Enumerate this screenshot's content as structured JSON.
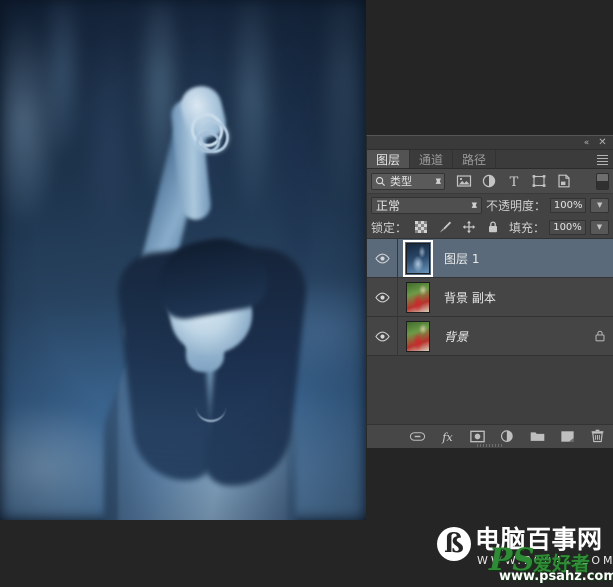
{
  "canvas": {
    "name": "blue-toned-portrait-photo",
    "description": "Blue duotone photograph of a young woman reaching upward holding rings, blurred forest background"
  },
  "panel": {
    "titlebar": {
      "collapse_icon": "collapse-double-arrow-icon",
      "collapse_glyph": "«",
      "close_icon": "close-icon",
      "close_glyph": "✕"
    },
    "tabs": [
      {
        "label": "图层",
        "name": "tab-layers",
        "active": true
      },
      {
        "label": "通道",
        "name": "tab-channels",
        "active": false
      },
      {
        "label": "路径",
        "name": "tab-paths",
        "active": false
      }
    ],
    "menu_icon": "panel-menu-icon",
    "filter_row": {
      "search_icon": "search-icon",
      "filter_type_value": "类型",
      "icons": [
        {
          "name": "filter-pixel-layers-icon",
          "title": "pixel"
        },
        {
          "name": "filter-adjustment-layers-icon",
          "title": "adjustment"
        },
        {
          "name": "filter-type-layers-icon",
          "title": "type"
        },
        {
          "name": "filter-shape-layers-icon",
          "title": "shape"
        },
        {
          "name": "filter-smart-object-icon",
          "title": "smart object"
        }
      ],
      "toggle_name": "filter-enable-toggle"
    },
    "mode_row": {
      "blend_mode": "正常",
      "opacity_label": "不透明度：",
      "opacity_value": "100%"
    },
    "lock_row": {
      "lock_label": "锁定：",
      "lock_icons": [
        {
          "name": "lock-transparent-pixels-icon"
        },
        {
          "name": "lock-image-pixels-icon"
        },
        {
          "name": "lock-position-icon"
        },
        {
          "name": "lock-all-icon"
        }
      ],
      "fill_label": "填充：",
      "fill_value": "100%"
    },
    "layers": [
      {
        "name": "图层 1",
        "visible": true,
        "selected": true,
        "italic": false,
        "locked": false,
        "thumb": "blue"
      },
      {
        "name": "背景 副本",
        "visible": true,
        "selected": false,
        "italic": false,
        "locked": false,
        "thumb": "color"
      },
      {
        "name": "背景",
        "visible": true,
        "selected": false,
        "italic": true,
        "locked": true,
        "thumb": "color"
      }
    ],
    "footer_buttons": [
      {
        "name": "link-layers-button",
        "glyph": "⚭"
      },
      {
        "name": "layer-style-fx-button",
        "glyph": "fx"
      },
      {
        "name": "add-layer-mask-button",
        "glyph": "▣"
      },
      {
        "name": "new-fill-adjustment-layer-button",
        "glyph": "◑"
      },
      {
        "name": "new-group-button",
        "glyph": "▰"
      },
      {
        "name": "new-layer-button",
        "glyph": "⧉"
      },
      {
        "name": "delete-layer-button",
        "glyph": "␢"
      }
    ]
  },
  "watermark": {
    "logo_glyph": "ß",
    "site_title": "电脑百事网",
    "site_url": "WWW.PC841.COM",
    "ps_text": "PS",
    "ps_cn_text": "爱好者",
    "ps_url": "www.psahz.com"
  },
  "colors": {
    "panel_bg": "#434343",
    "panel_row": "#454545",
    "selected_layer": "#5a6a7a",
    "text": "#e9e9e9",
    "desktop_bg": "#252525",
    "watermark_green": "#2f8b35"
  }
}
